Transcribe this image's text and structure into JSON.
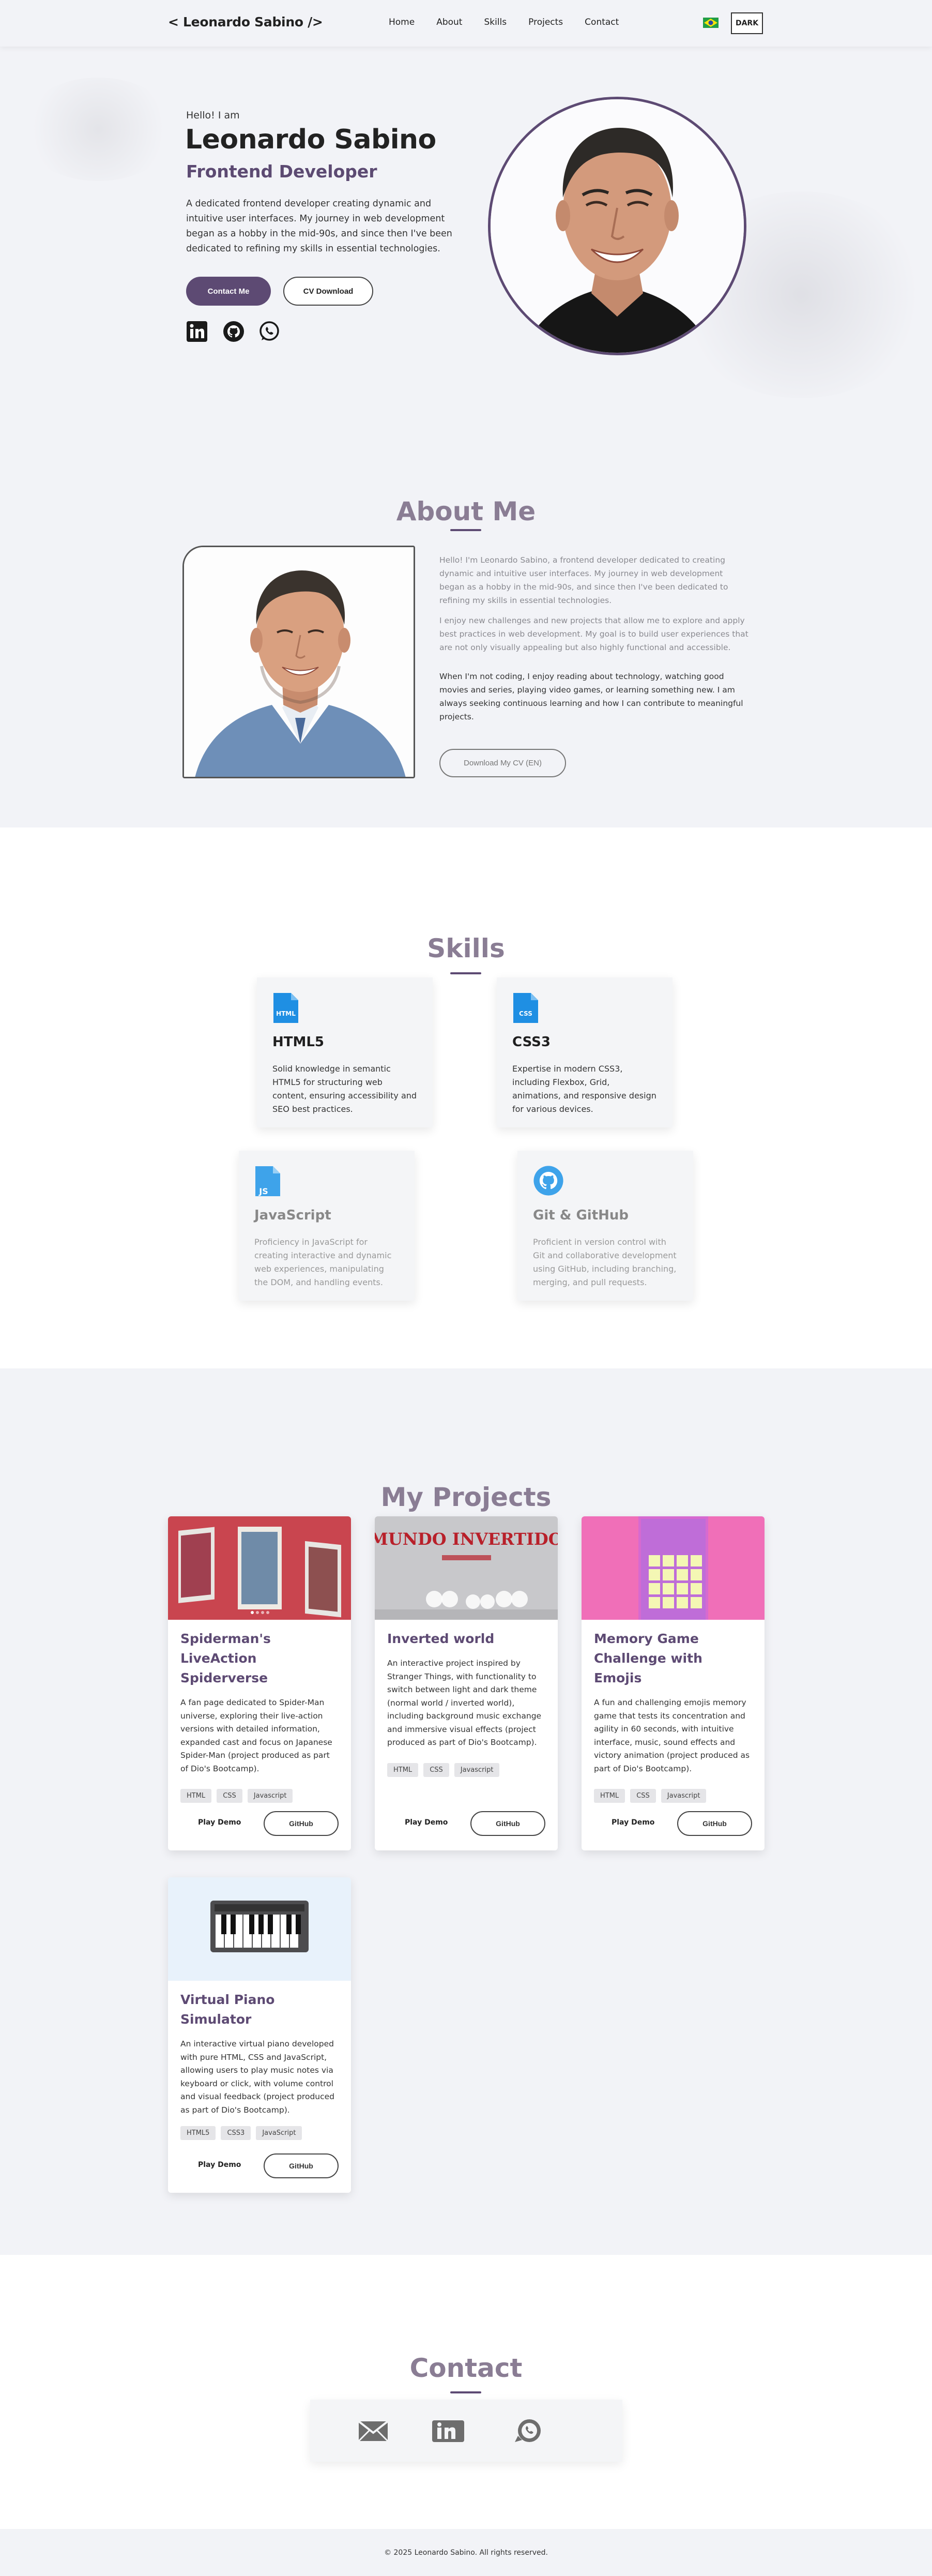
{
  "nav": {
    "logo": "< Leonardo Sabino />",
    "links": [
      "Home",
      "About",
      "Skills",
      "Projects",
      "Contact"
    ],
    "theme_button": "DARK",
    "flag_icon": "brazil-flag-icon"
  },
  "hero": {
    "greeting": "Hello! I am",
    "name": "Leonardo Sabino",
    "role": "Frontend Developer",
    "description": "A dedicated frontend developer creating dynamic and intuitive user interfaces. My journey in web development began as a hobby in the mid-90s, and since then I've been dedicated to refining my skills in essential technologies.",
    "contact_button": "Contact Me",
    "cv_button": "CV Download",
    "socials": [
      "linkedin-icon",
      "github-icon",
      "whatsapp-icon"
    ]
  },
  "about": {
    "title": "About Me",
    "paragraphs": [
      "Hello! I'm Leonardo Sabino, a frontend developer dedicated to creating dynamic and intuitive user interfaces. My journey in web development began as a hobby in the mid-90s, and since then I've been dedicated to refining my skills in essential technologies.",
      "I enjoy new challenges and new projects that allow me to explore and apply best practices in web development. My goal is to build user experiences that are not only visually appealing but also highly functional and accessible.",
      "When I'm not coding, I enjoy reading about technology, watching good movies and series, playing video games, or learning something new. I am always seeking continuous learning and how I can contribute to meaningful projects."
    ],
    "cv_button": "Download My CV (EN)"
  },
  "skills": {
    "title": "Skills",
    "items": [
      {
        "name": "HTML5",
        "icon": "html5-file-icon",
        "icon_label": "HTML",
        "description": "Solid knowledge in semantic HTML5 for structuring web content, ensuring accessibility and SEO best practices."
      },
      {
        "name": "CSS3",
        "icon": "css3-file-icon",
        "icon_label": "CSS",
        "description": "Expertise in modern CSS3, including Flexbox, Grid, animations, and responsive design for various devices."
      },
      {
        "name": "JavaScript",
        "icon": "javascript-file-icon",
        "icon_label": "JS",
        "description": "Proficiency in JavaScript for creating interactive and dynamic web experiences, manipulating the DOM, and handling events."
      },
      {
        "name": "Git & GitHub",
        "icon": "github-icon",
        "icon_label": "",
        "description": "Proficient in version control with Git and collaborative development using GitHub, including branching, merging, and pull requests."
      }
    ]
  },
  "projects": {
    "title": "My Projects",
    "play_label": "Play Demo",
    "github_label": "GitHub",
    "items": [
      {
        "title": "Spiderman's LiveAction Spiderverse",
        "description": "A fan page dedicated to Spider-Man universe, exploring their live-action versions with detailed information, expanded cast and focus on Japanese Spider-Man (project produced as part of Dio's Bootcamp).",
        "tags": [
          "HTML",
          "CSS",
          "Javascript"
        ],
        "thumb_color": "#c9454f"
      },
      {
        "title": "Inverted world",
        "description": "An interactive project inspired by Stranger Things, with functionality to switch between light and dark theme (normal world / inverted world), including background music exchange and immersive visual effects (project produced as part of Dio's Bootcamp).",
        "tags": [
          "HTML",
          "CSS",
          "Javascript"
        ],
        "thumb_color": "#c8c8cb",
        "thumb_text": "MUNDO INVERTIDO"
      },
      {
        "title": "Memory Game Challenge with Emojis",
        "description": "A fun and challenging emojis memory game that tests its concentration and agility in 60 seconds, with intuitive interface, music, sound effects and victory animation (project produced as part of Dio's Bootcamp).",
        "tags": [
          "HTML",
          "CSS",
          "Javascript"
        ],
        "thumb_color": "#f06fb8"
      },
      {
        "title": "Virtual Piano Simulator",
        "description": "An interactive virtual piano developed with pure HTML, CSS and JavaScript, allowing users to play music notes via keyboard or click, with volume control and visual feedback (project produced as part of Dio's Bootcamp).",
        "tags": [
          "HTML5",
          "CSS3",
          "JavaScript"
        ],
        "thumb_color": "#e8f2fb"
      }
    ]
  },
  "contact": {
    "title": "Contact",
    "icons": [
      "email-icon",
      "linkedin-icon",
      "whatsapp-icon"
    ]
  },
  "footer": {
    "text": "© 2025 Leonardo Sabino. All rights reserved."
  }
}
